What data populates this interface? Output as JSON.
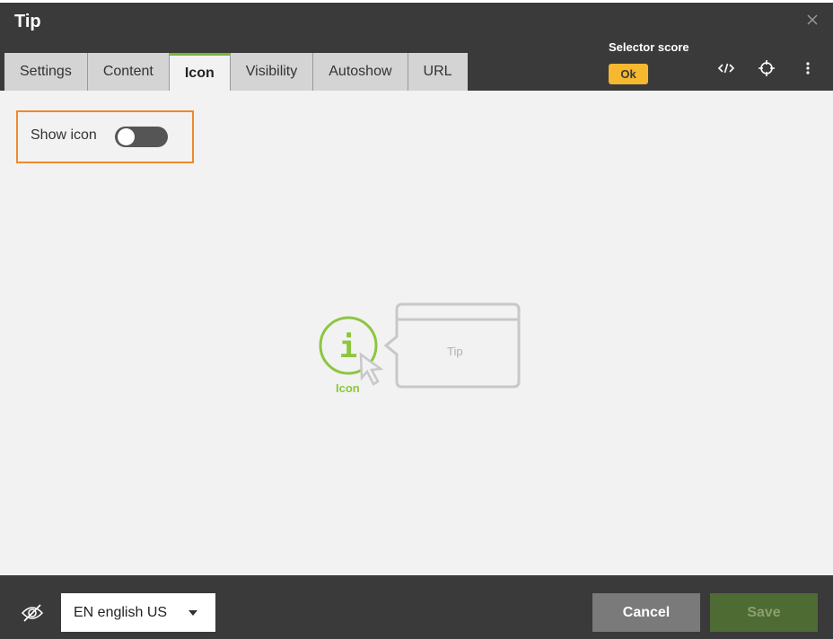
{
  "dialog": {
    "title": "Tip"
  },
  "tabs": [
    {
      "label": "Settings",
      "active": false
    },
    {
      "label": "Content",
      "active": false
    },
    {
      "label": "Icon",
      "active": true
    },
    {
      "label": "Visibility",
      "active": false
    },
    {
      "label": "Autoshow",
      "active": false
    },
    {
      "label": "URL",
      "active": false
    }
  ],
  "selector_score": {
    "label": "Selector score",
    "value": "Ok",
    "color": "#f5b82e"
  },
  "header_icons": [
    "code-icon",
    "crosshair-icon",
    "more-vertical-icon",
    "close-icon"
  ],
  "icon_settings": {
    "show_icon_label": "Show icon",
    "show_icon": false
  },
  "preview": {
    "icon_caption": "Icon",
    "tip_text": "Tip",
    "accent": "#8cc63f"
  },
  "footer": {
    "language": "EN english US",
    "cancel_label": "Cancel",
    "save_label": "Save",
    "visibility_icon": "eye-off-icon"
  },
  "colors": {
    "highlight": "#ef8a2c",
    "header": "#3a3a3a",
    "save": "#4f6b34"
  }
}
